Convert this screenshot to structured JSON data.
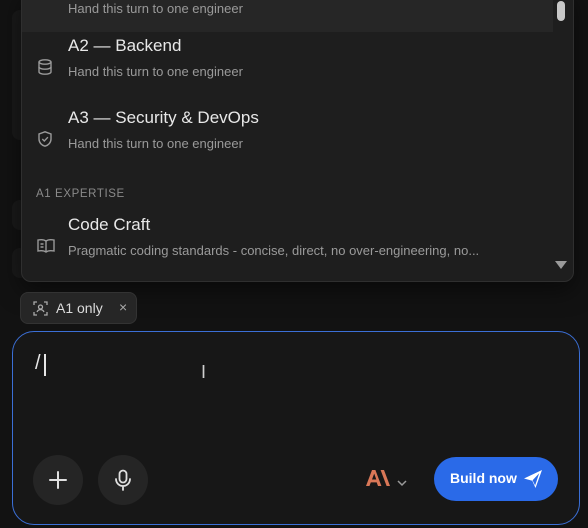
{
  "menu": {
    "items": [
      {
        "title": "",
        "subtitle": "Hand this turn to one engineer",
        "icon": "server-icon"
      },
      {
        "title": "A2 — Backend",
        "subtitle": "Hand this turn to one engineer",
        "icon": "database-icon"
      },
      {
        "title": "A3 — Security & DevOps",
        "subtitle": "Hand this turn to one engineer",
        "icon": "shield-check-icon"
      }
    ],
    "section_label": "A1 EXPERTISE",
    "expertise_items": [
      {
        "title": "Code Craft",
        "subtitle": "Pragmatic coding standards - concise, direct, no over-engineering, no...",
        "icon": "book-open-icon"
      }
    ]
  },
  "chip": {
    "label": "A1 only",
    "close": "×",
    "icon": "focus-frame-icon"
  },
  "composer": {
    "input_value": "/",
    "model_icon": "anthropic-logo-icon",
    "model_color": "#d97757",
    "build_label": "Build now",
    "accent": "#2a6ae8"
  }
}
